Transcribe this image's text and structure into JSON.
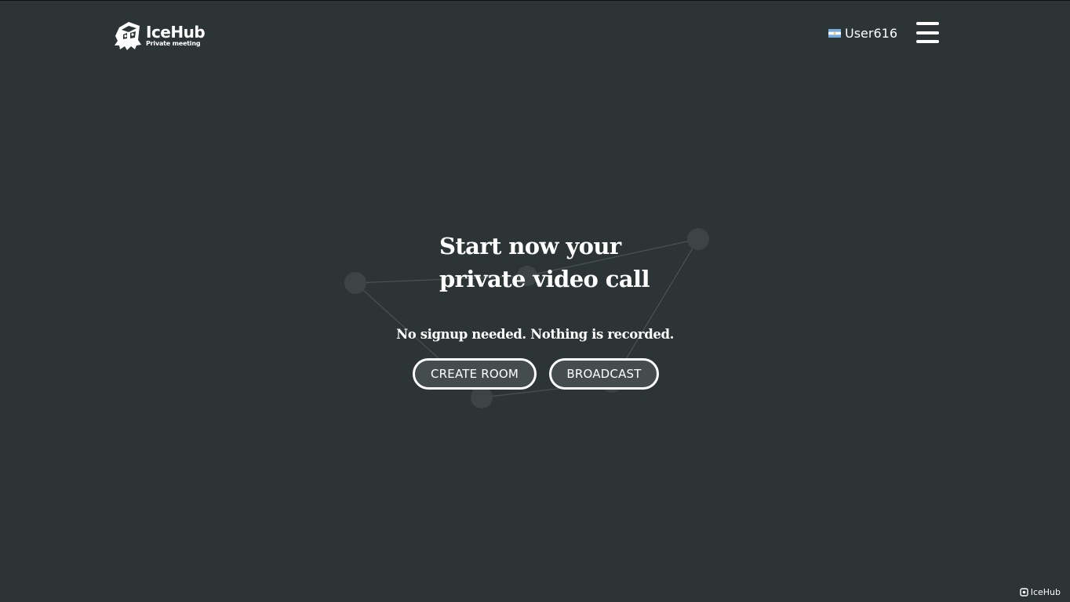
{
  "header": {
    "logo": {
      "name": "IceHub",
      "tagline": "Private meeting"
    },
    "user": {
      "flag": "argentina-flag-icon",
      "name": "User616"
    },
    "menu_icon": "hamburger-menu-icon"
  },
  "hero": {
    "title_line_1": "Start now your",
    "title_line_2": "private video call",
    "subtitle": "No signup needed. Nothing is recorded."
  },
  "actions": {
    "create_room_label": "CREATE ROOM",
    "broadcast_label": "BROADCAST"
  },
  "footer": {
    "badge_label": "IceHub",
    "badge_icon": "icehub-small-icon"
  },
  "colors": {
    "background": "#2d3435",
    "text": "#ffffff",
    "button_fill": "#454c4d",
    "button_border": "#ffffff",
    "network_node": "#3c4445",
    "network_line": "#4a5253"
  }
}
